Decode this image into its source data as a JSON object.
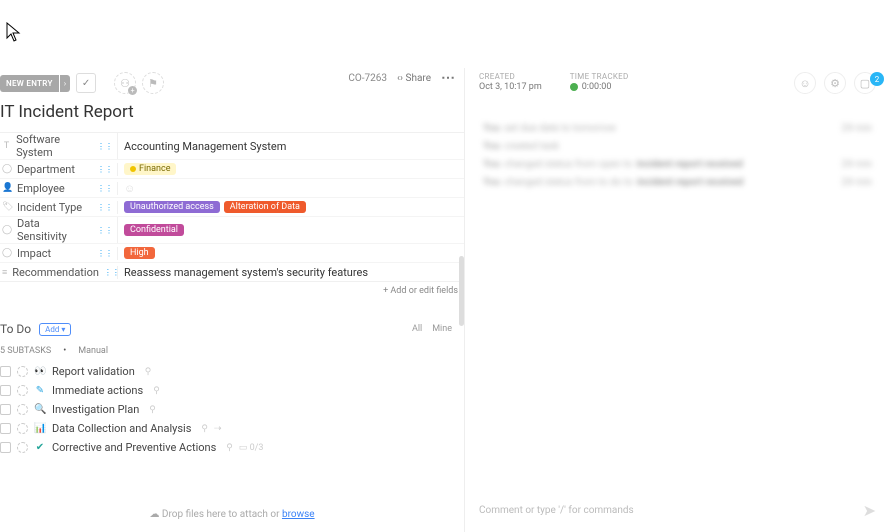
{
  "toolbar": {
    "new_entry": "NEW ENTRY",
    "task_id": "CO-7263",
    "share": "Share"
  },
  "title": "IT Incident Report",
  "fields": [
    {
      "icon": "T",
      "label": "Software System",
      "value_text": "Accounting Management System"
    },
    {
      "icon": "◯",
      "label": "Department",
      "tags": [
        {
          "text": "Finance",
          "bg": "#fff6c9",
          "fg": "#7a6a00",
          "dot": "#f0c400"
        }
      ]
    },
    {
      "icon": "👤",
      "label": "Employee",
      "value_text": ""
    },
    {
      "icon": "🏷",
      "label": "Incident Type",
      "tags": [
        {
          "text": "Unauthorized access",
          "bg": "#8e6bd4",
          "fg": "#fff"
        },
        {
          "text": "Alteration of Data",
          "bg": "#ef5a2c",
          "fg": "#fff"
        }
      ]
    },
    {
      "icon": "◯",
      "label": "Data Sensitivity",
      "tags": [
        {
          "text": "Confidential",
          "bg": "#c14b9b",
          "fg": "#fff"
        }
      ]
    },
    {
      "icon": "◯",
      "label": "Impact",
      "tags": [
        {
          "text": "High",
          "bg": "#f2673c",
          "fg": "#fff"
        }
      ]
    },
    {
      "icon": "≡",
      "label": "Recommendation",
      "value_text": "Reassess management system's security features"
    }
  ],
  "add_fields": "+ Add or edit fields",
  "todo": {
    "title": "To Do",
    "add": "Add ▾"
  },
  "filters": {
    "all": "All",
    "mine": "Mine"
  },
  "subtasks_hdr": {
    "count": "5 SUBTASKS",
    "manual": "Manual"
  },
  "subtasks": [
    {
      "icon": "👀",
      "icolor": "#e6b800",
      "name": "Report validation",
      "extras": [
        "⚲"
      ]
    },
    {
      "icon": "✎",
      "icolor": "#2aa5e0",
      "name": "Immediate actions",
      "extras": [
        "⚲"
      ]
    },
    {
      "icon": "🔍",
      "icolor": "#2aa5e0",
      "name": "Investigation Plan",
      "extras": [
        "⚲"
      ]
    },
    {
      "icon": "📊",
      "icolor": "#f06292",
      "name": "Data Collection and Analysis",
      "extras": [
        "⚲",
        "⇢"
      ]
    },
    {
      "icon": "✔",
      "icolor": "#26a69a",
      "name": "Corrective and Preventive Actions",
      "extras": [
        "⚲",
        "▭ 0/3"
      ]
    }
  ],
  "dropzone": {
    "prefix": "Drop files here to attach or ",
    "link": "browse"
  },
  "side": {
    "created_lbl": "CREATED",
    "created_val": "Oct 3, 10:17 pm",
    "tracked_lbl": "TIME TRACKED",
    "tracked_val": "0:00:00",
    "notif": "2"
  },
  "activity": [
    {
      "who": "You",
      "text": "set due date to tomorrow",
      "when": "24 min"
    },
    {
      "who": "You",
      "text": "created task",
      "when": ""
    },
    {
      "who": "You",
      "text": "changed status from open to",
      "strong": "incident report received",
      "when": "24 min"
    },
    {
      "who": "You",
      "text": "changed status from to do to",
      "strong": "incident report received",
      "when": "24 min"
    }
  ],
  "comment": {
    "placeholder": "Comment or type '/' for commands"
  }
}
